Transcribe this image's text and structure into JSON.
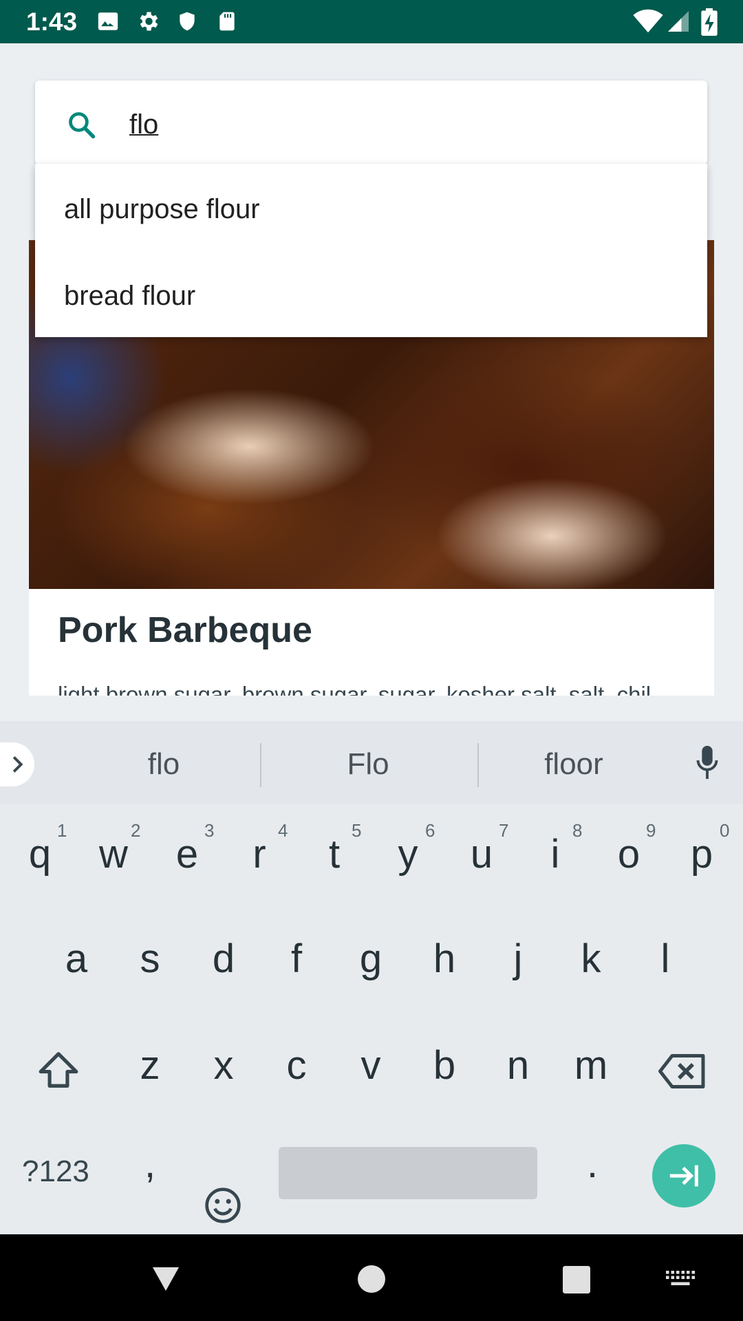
{
  "status_bar": {
    "time": "1:43",
    "left_icons": [
      "image-icon",
      "gear-icon",
      "shield-icon",
      "sd-card-icon"
    ],
    "right_icons": [
      "wifi-icon",
      "signal-icon",
      "battery-charging-icon"
    ],
    "background_color": "#005a4d"
  },
  "search": {
    "value": "flo",
    "icon_color": "#00897b"
  },
  "autocomplete": {
    "items": [
      "all purpose flour",
      "bread flour"
    ]
  },
  "recipe_card": {
    "title": "Pork Barbeque",
    "ingredients": "light brown sugar, brown sugar, sugar, kosher salt, salt, chil"
  },
  "keyboard": {
    "suggestions": [
      "flo",
      "Flo",
      "floor"
    ],
    "row1": [
      "q",
      "w",
      "e",
      "r",
      "t",
      "y",
      "u",
      "i",
      "o",
      "p"
    ],
    "row1_hints": [
      "1",
      "2",
      "3",
      "4",
      "5",
      "6",
      "7",
      "8",
      "9",
      "0"
    ],
    "row2": [
      "a",
      "s",
      "d",
      "f",
      "g",
      "h",
      "j",
      "k",
      "l"
    ],
    "row3": [
      "z",
      "x",
      "c",
      "v",
      "b",
      "n",
      "m"
    ],
    "symbols_label": "?123",
    "comma": ",",
    "period": ".",
    "accent_color": "#3fbfa7"
  },
  "nav_bar": {
    "icons": [
      "back-icon",
      "home-icon",
      "recents-icon",
      "keyboard-switch-icon"
    ]
  }
}
